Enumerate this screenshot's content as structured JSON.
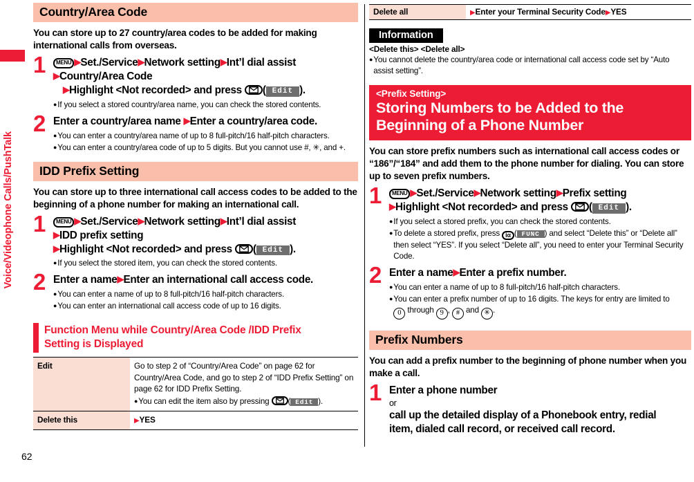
{
  "sidebar": {
    "chapter_label": "Voice/Videophone Calls/PushTalk",
    "tab_color": "#ED1C35"
  },
  "page": {
    "number": "62"
  },
  "colors": {
    "accent_red": "#ED1C35",
    "heading_peach": "#F9BFAA",
    "table_cell_pink": "#FBDED3",
    "softkey_gray": "#6E6E6E"
  },
  "left_column": {
    "section1": {
      "heading": "Country/Area Code",
      "lead": "You can store up to 27 country/area codes to be added for making international calls from overseas.",
      "steps": [
        {
          "num": "1",
          "line1_a": "Set./Service",
          "line1_b": "Network setting",
          "line1_c": "Int’l dial assist",
          "line2": "Country/Area Code",
          "line3_pre": "Highlight <Not recorded> and press",
          "line3_key": "mail-key",
          "line3_softkey": "Edit",
          "notes": [
            "If you select a stored country/area name, you can check the stored contents."
          ]
        },
        {
          "num": "2",
          "head_a": "Enter a country/area name",
          "head_b": "Enter a country/area code.",
          "notes": [
            "You can enter a country/area name of up to 8 full-pitch/16 half-pitch characters.",
            "You can enter a country/area code of up to 5 digits. But you cannot use #, ✳, and +."
          ]
        }
      ]
    },
    "section2": {
      "heading": "IDD Prefix Setting",
      "lead": "You can store up to three international call access codes to be added to the beginning of a phone number for making an international call.",
      "steps": [
        {
          "num": "1",
          "line1_a": "Set./Service",
          "line1_b": "Network setting",
          "line1_c": "Int’l dial assist",
          "line2": "IDD prefix setting",
          "line3_pre": "Highlight <Not recorded> and press",
          "line3_softkey": "Edit",
          "notes": [
            "If you select the stored item, you can check the stored contents."
          ]
        },
        {
          "num": "2",
          "head_a": "Enter a name",
          "head_b": "Enter an international call access code.",
          "notes": [
            "You can enter a name of up to 8 full-pitch/16 half-pitch characters.",
            "You can enter an international call access code of up to 16 digits."
          ]
        }
      ]
    },
    "function_menu": {
      "heading_line1": "Function Menu while Country/Area Code /IDD Prefix",
      "heading_line2": "Setting is Displayed",
      "rows": [
        {
          "label": "Edit",
          "body": "Go to step 2 of “Country/Area Code” on page 62 for Country/Area Code, and go to step 2 of “IDD Prefix Setting” on page 62 for IDD Prefix Setting.",
          "note_pre": "You can edit the item also by pressing",
          "note_softkey": "Edit",
          "note_post": ")."
        },
        {
          "label": "Delete this",
          "value": "YES"
        }
      ]
    }
  },
  "right_column": {
    "table_top": {
      "label": "Delete all",
      "value_a": "Enter your Terminal Security Code",
      "value_b": "YES"
    },
    "information": {
      "heading": "Information",
      "subheading": "<Delete this> <Delete all>",
      "notes": [
        "You cannot delete the country/area code or international call access code set by “Auto assist setting”."
      ]
    },
    "prefix_section": {
      "kicker": "<Prefix Setting>",
      "title_line1": "Storing Numbers to be Added to the",
      "title_line2": "Beginning of a Phone Number",
      "lead": "You can store prefix numbers such as international call access codes or “186”/“184” and add them to the phone number for dialing. You can store up to seven prefix numbers.",
      "steps": [
        {
          "num": "1",
          "line1_a": "Set./Service",
          "line1_b": "Network setting",
          "line1_c": "Prefix setting",
          "line2_pre": "Highlight <Not recorded> and press",
          "line2_softkey": "Edit",
          "notes": [
            "If you select a stored prefix, you can check the stored contents.",
            "To delete a stored prefix, press"
          ],
          "note2_softkey": "FUNC",
          "note2_rest": ") and select “Delete this” or “Delete all” then select “YES”. If you select “Delete all”, you need to enter your Terminal Security Code."
        },
        {
          "num": "2",
          "head_a": "Enter a name",
          "head_b": "Enter a prefix number.",
          "notes": [
            "You can enter a name of up to 8 full-pitch/16 half-pitch characters."
          ],
          "note2_pre": "You can enter a prefix number of up to 16 digits. The keys for entry are limited to",
          "keys": [
            "0",
            "through",
            "9",
            "#",
            "and",
            "✳"
          ]
        }
      ]
    },
    "prefix_numbers": {
      "heading": "Prefix Numbers",
      "lead": "You can add a prefix number to the beginning of phone number when you make a call.",
      "step": {
        "num": "1",
        "line1": "Enter a phone number",
        "or": "or",
        "line2": "call up the detailed display of a Phonebook entry, redial",
        "line3": "item, dialed call record, or received call record."
      }
    }
  }
}
